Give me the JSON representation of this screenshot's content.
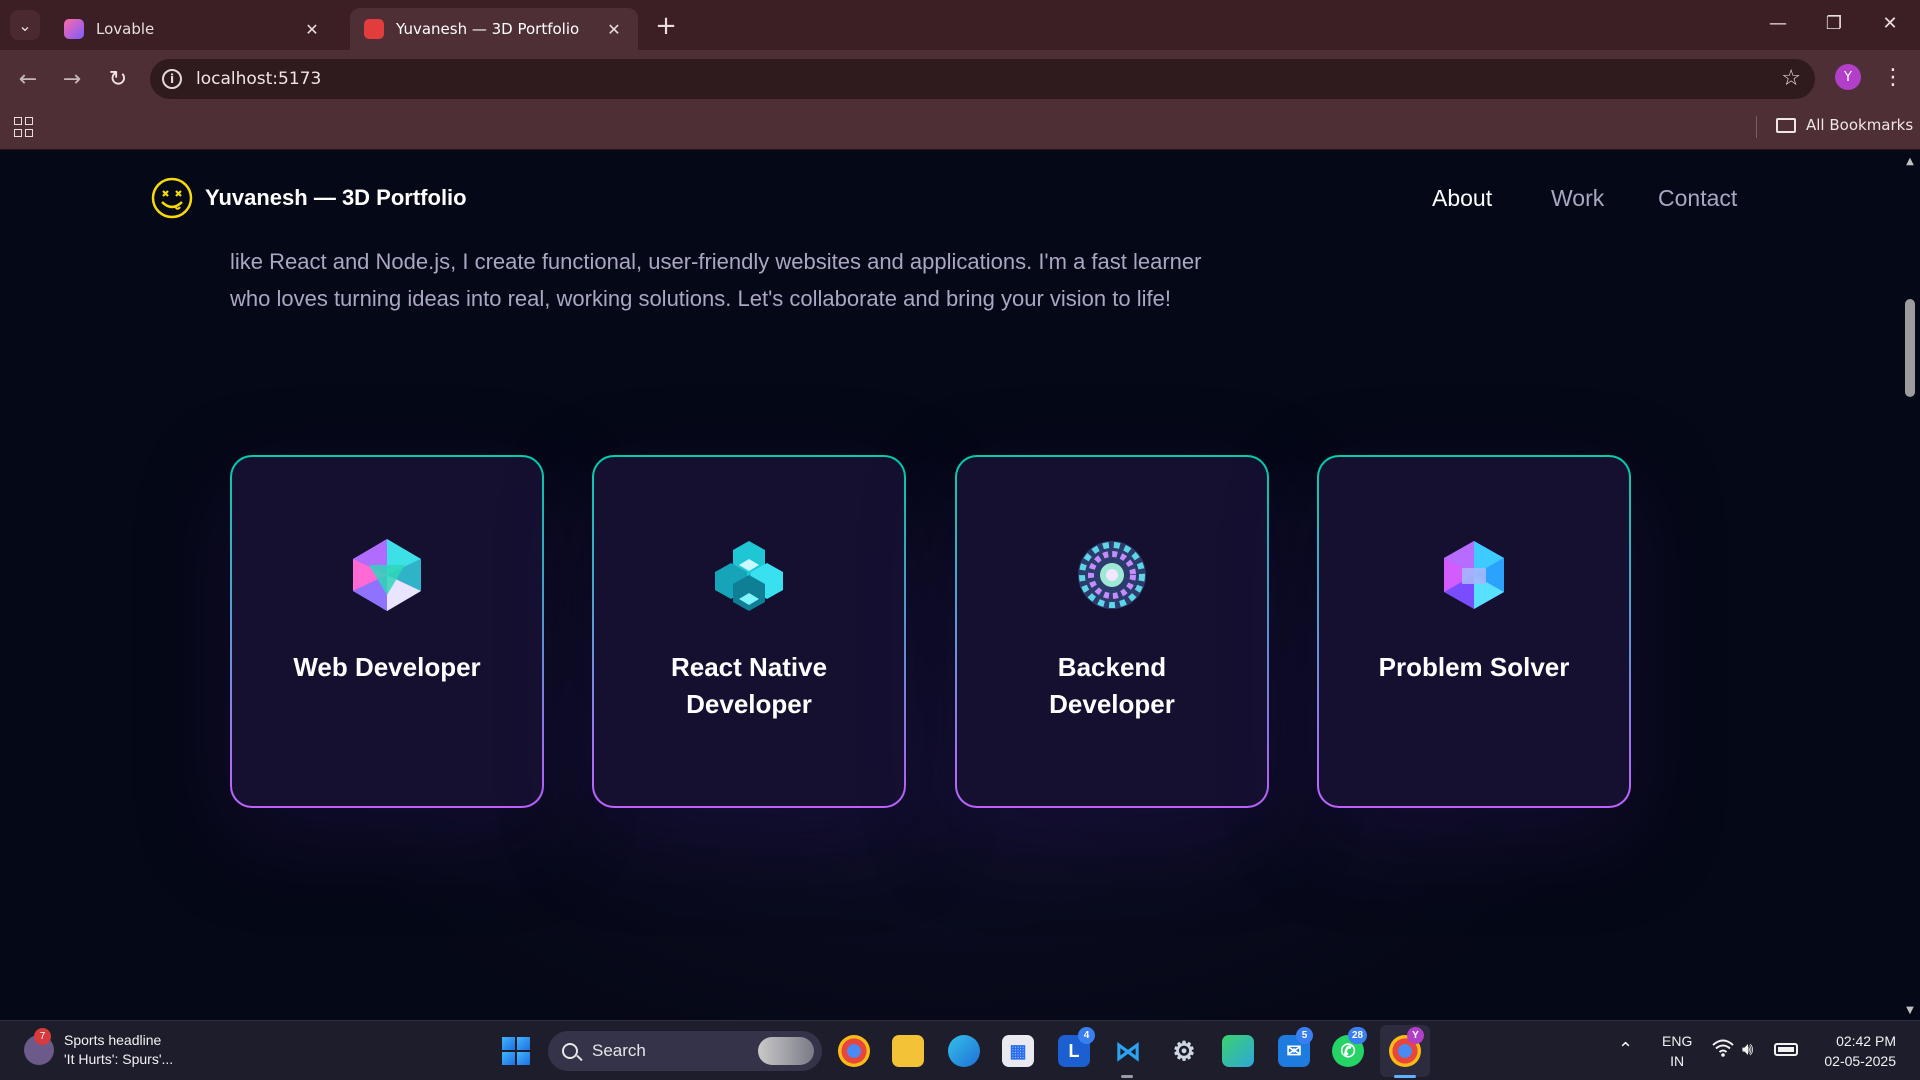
{
  "browser": {
    "tabs": [
      {
        "title": "Lovable",
        "active": false
      },
      {
        "title": "Yuvanesh — 3D Portfolio",
        "active": true
      }
    ],
    "url": "localhost:5173",
    "profile_initial": "Y",
    "bookmarks_label": "All Bookmarks"
  },
  "site": {
    "brand": "Yuvanesh — 3D Portfolio",
    "nav": [
      {
        "label": "About",
        "active": true
      },
      {
        "label": "Work",
        "active": false
      },
      {
        "label": "Contact",
        "active": false
      }
    ],
    "intro": "like React and Node.js, I create functional, user-friendly websites and applications. I'm a fast learner who loves turning ideas into real, working solutions. Let's collaborate and bring your vision to life!",
    "services": [
      {
        "title": "Web Developer",
        "icon": "web-developer-icon"
      },
      {
        "title": "React Native Developer",
        "icon": "react-native-developer-icon"
      },
      {
        "title": "Backend Developer",
        "icon": "backend-developer-icon"
      },
      {
        "title": "Problem Solver",
        "icon": "problem-solver-icon"
      }
    ],
    "colors": {
      "background": "#050816",
      "card": "#151030",
      "gradient_start": "#00cea8",
      "gradient_end": "#bf61ff",
      "secondary_text": "#aaa6c3"
    }
  },
  "taskbar": {
    "widget": {
      "headline": "Sports headline",
      "subtext": "'It Hurts': Spurs'...",
      "badge": "7"
    },
    "search_label": "Search",
    "badges": {
      "l_app": "4",
      "mail": "5",
      "whatsapp": "28",
      "chrome_profile": "Y"
    },
    "language": {
      "line1": "ENG",
      "line2": "IN"
    },
    "time": "02:42 PM",
    "date": "02-05-2025"
  }
}
